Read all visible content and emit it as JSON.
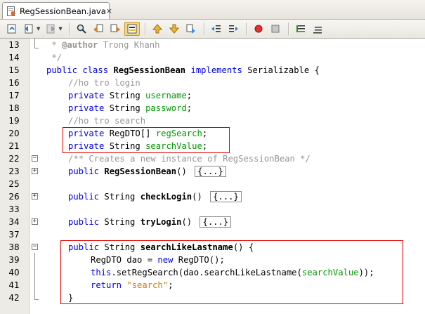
{
  "tab": {
    "title": "RegSessionBean.java",
    "close": "×"
  },
  "toolbar": {
    "buttons": [
      "last-edit-icon",
      "back-icon",
      "forward-icon",
      "find-selection-icon",
      "find-previous-icon",
      "find-next-icon",
      "toggle-highlight-icon",
      "previous-bookmark-icon",
      "next-bookmark-icon",
      "toggle-bookmark-icon",
      "shift-left-icon",
      "shift-right-icon",
      "start-macro-icon",
      "stop-macro-icon",
      "comment-icon",
      "uncomment-icon"
    ]
  },
  "colors": {
    "keyword": "#0000e6",
    "comment": "#969696",
    "field": "#009900",
    "string": "#ce7b00",
    "highlight_box": "#e00000"
  },
  "lines": [
    {
      "n": "13",
      "t": " * @author Trong Khanh"
    },
    {
      "n": "14",
      "t": " */"
    },
    {
      "n": "15",
      "t": "public class RegSessionBean implements Serializable {"
    },
    {
      "n": "16",
      "t": "//ho tro login"
    },
    {
      "n": "17",
      "t": "private String username;"
    },
    {
      "n": "18",
      "t": "private String password;"
    },
    {
      "n": "19",
      "t": "//ho tro search"
    },
    {
      "n": "20",
      "t": "private RegDTO[] regSearch;"
    },
    {
      "n": "21",
      "t": "private String searchValue;"
    },
    {
      "n": "22",
      "t": "/** Creates a new instance of RegSessionBean */"
    },
    {
      "n": "23",
      "t": "public RegSessionBean()"
    },
    {
      "n": "25",
      "t": ""
    },
    {
      "n": "26",
      "t": "public String checkLogin()"
    },
    {
      "n": "33",
      "t": ""
    },
    {
      "n": "34",
      "t": "public String tryLogin()"
    },
    {
      "n": "37",
      "t": ""
    },
    {
      "n": "38",
      "t": "public String searchLikeLastname() {"
    },
    {
      "n": "39",
      "t": "RegDTO dao = new RegDTO();"
    },
    {
      "n": "40",
      "t": "this.setRegSearch(dao.searchLikeLastname(searchValue));"
    },
    {
      "n": "41",
      "t": "return \"search\";"
    },
    {
      "n": "42",
      "t": "}"
    }
  ],
  "tokens": {
    "l13": {
      "star": " * ",
      "tag": "@author",
      "rest": " Trong Khanh"
    },
    "l14": {
      "a": " */"
    },
    "l15": {
      "k1": "public",
      "k2": "class",
      "name": "RegSessionBean",
      "k3": "implements",
      "rest": "Serializable {"
    },
    "l16": {
      "a": "//ho tro login"
    },
    "l17": {
      "k": "private",
      "t": "String",
      "f": "username",
      "e": ";"
    },
    "l18": {
      "k": "private",
      "t": "String",
      "f": "password",
      "e": ";"
    },
    "l19": {
      "a": "//ho tro search"
    },
    "l20": {
      "k": "private",
      "t": "RegDTO[]",
      "f": "regSearch",
      "e": ";"
    },
    "l21": {
      "k": "private",
      "t": "String",
      "f": "searchValue",
      "e": ";"
    },
    "l22": {
      "a": "/** Creates a new instance of RegSessionBean */"
    },
    "l23": {
      "k": "public",
      "name": "RegSessionBean",
      "p": "()",
      "c": "{...}"
    },
    "l26": {
      "k": "public",
      "t": "String",
      "name": "checkLogin",
      "p": "()",
      "c": "{...}"
    },
    "l34": {
      "k": "public",
      "t": "String",
      "name": "tryLogin",
      "p": "()",
      "c": "{...}"
    },
    "l38": {
      "k": "public",
      "t": "String",
      "name": "searchLikeLastname",
      "p": "() {"
    },
    "l39": {
      "a": "RegDTO dao = ",
      "k": "new",
      "b": " RegDTO();"
    },
    "l40": {
      "k": "this",
      "a": ".setRegSearch(dao.searchLikeLastname(",
      "f": "searchValue",
      "b": "));"
    },
    "l41": {
      "k": "return",
      "s": "\"search\"",
      "e": ";"
    },
    "l42": {
      "a": "}"
    }
  }
}
